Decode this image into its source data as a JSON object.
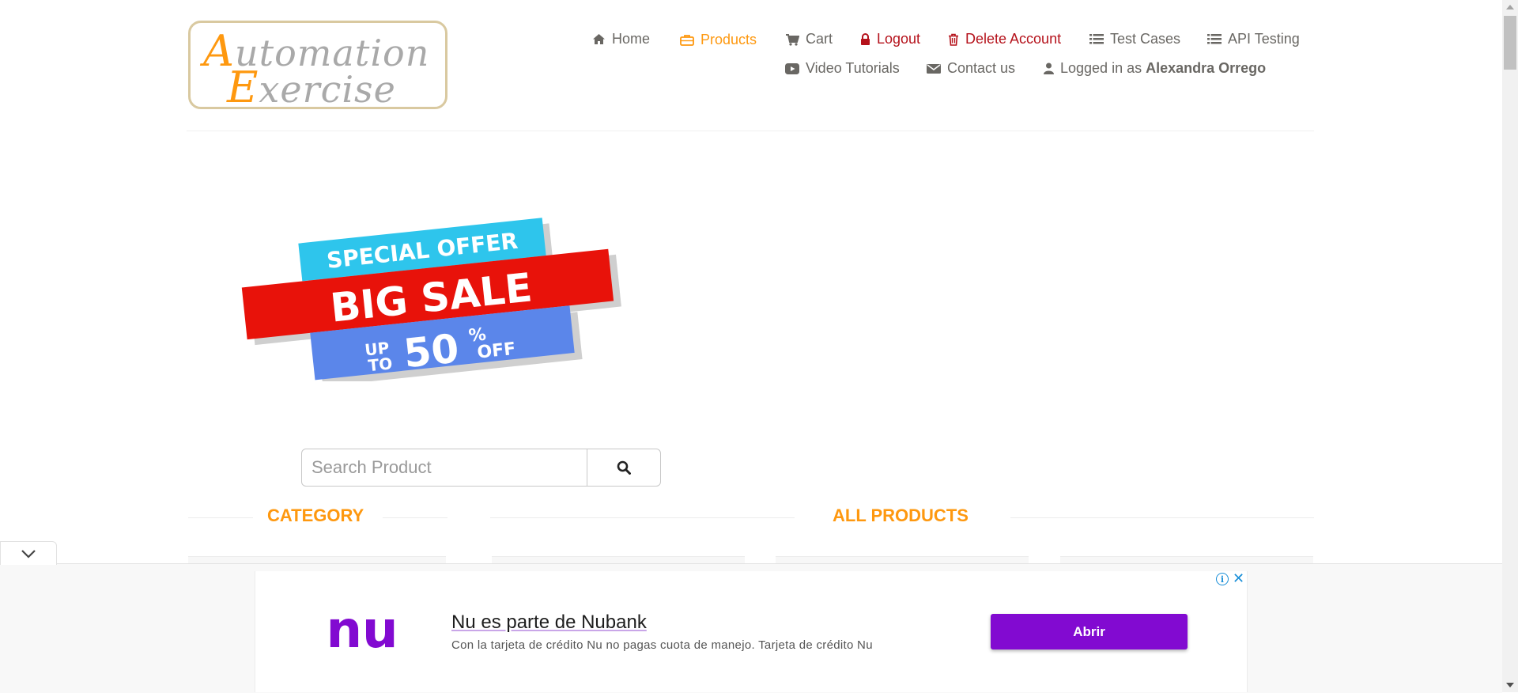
{
  "brand": {
    "line1_cap": "A",
    "line1_rest": "utomation",
    "line2_cap": "E",
    "line2_rest": "xercise"
  },
  "nav": {
    "home": "Home",
    "products": "Products",
    "cart": "Cart",
    "logout": "Logout",
    "delete_account": "Delete Account",
    "test_cases": "Test Cases",
    "api_testing": "API Testing",
    "video_tutorials": "Video Tutorials",
    "contact_us": "Contact us",
    "logged_in_prefix": "Logged in as",
    "username": "Alexandra Orrego"
  },
  "banner": {
    "line1": "SPECIAL OFFER",
    "line2": "BIG SALE",
    "up": "UP",
    "to": "TO",
    "number": "50",
    "percent": "%",
    "off": "OFF"
  },
  "search": {
    "placeholder": "Search Product",
    "value": ""
  },
  "sections": {
    "category": "CATEGORY",
    "all_products": "ALL PRODUCTS"
  },
  "ad": {
    "title": "Nu es parte de Nubank",
    "description": "Con la tarjeta de crédito Nu no pagas cuota de manejo. Tarjeta de crédito Nu",
    "button": "Abrir",
    "logo_text": "nu",
    "info_glyph": "i",
    "close_glyph": "✕"
  },
  "colors": {
    "accent": "#fe980f",
    "danger": "#b5121b",
    "nubank": "#820ad1"
  }
}
